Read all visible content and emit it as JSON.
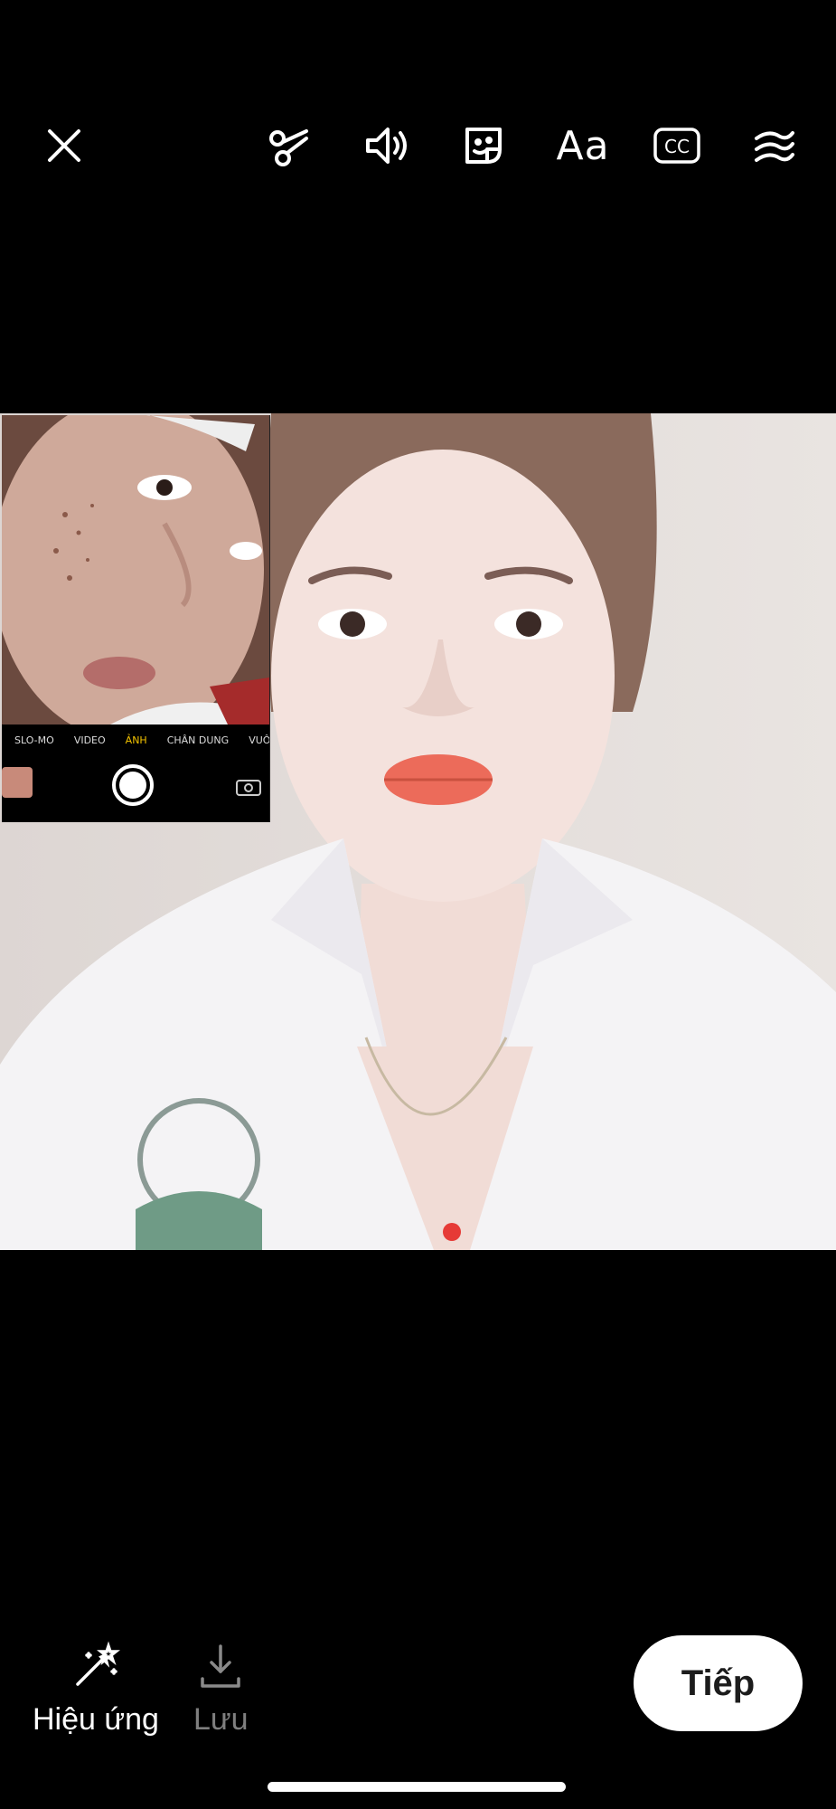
{
  "top_bar": {
    "icons": [
      "close-icon",
      "scissors-icon",
      "volume-icon",
      "sticker-icon",
      "text-icon",
      "captions-icon",
      "filter-icon"
    ],
    "text_label": "Aa",
    "captions_label": "CC"
  },
  "pip": {
    "modes": [
      "SLO-MO",
      "VIDEO",
      "ẢNH",
      "CHÂN DUNG",
      "VUÔ"
    ],
    "active_mode": "ẢNH"
  },
  "bottom_bar": {
    "effects_label": "Hiệu ứng",
    "save_label": "Lưu",
    "next_label": "Tiếp"
  },
  "colors": {
    "background": "#000000",
    "next_button_bg": "#ffffff",
    "dim_label": "#7f7f7f",
    "active_mode": "#f5c400"
  }
}
